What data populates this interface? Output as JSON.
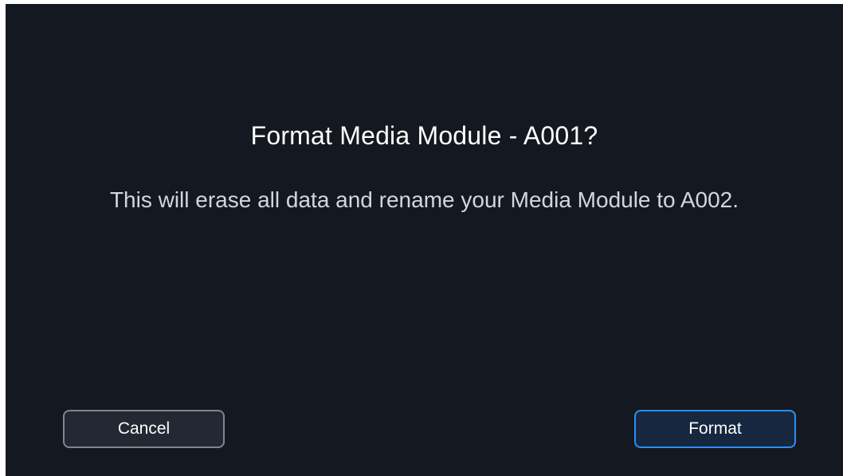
{
  "dialog": {
    "title": "Format Media Module - A001?",
    "message": "This will erase all data and rename your Media Module to A002.",
    "cancel_label": "Cancel",
    "confirm_label": "Format"
  },
  "colors": {
    "background": "#141820",
    "title_text": "#ffffff",
    "message_text": "#d2d6de",
    "cancel_border": "#80858f",
    "confirm_border": "#2d8ef5"
  }
}
